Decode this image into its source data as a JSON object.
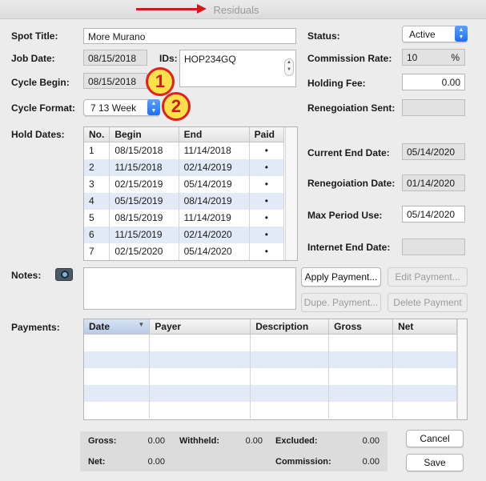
{
  "window": {
    "title": "Residuals"
  },
  "badges": {
    "one": "1",
    "two": "2"
  },
  "form": {
    "spot_title_label": "Spot Title:",
    "spot_title_value": "More Murano",
    "job_date_label": "Job Date:",
    "job_date_value": "08/15/2018",
    "ids_label": "IDs:",
    "ids_value": "HOP234GQ",
    "cycle_begin_label": "Cycle Begin:",
    "cycle_begin_value": "08/15/2018",
    "cycle_format_label": "Cycle Format:",
    "cycle_format_value": "7 13 Week",
    "hold_dates_label": "Hold Dates:",
    "notes_label": "Notes:",
    "payments_label": "Payments:"
  },
  "right": {
    "status_label": "Status:",
    "status_value": "Active",
    "commission_rate_label": "Commission Rate:",
    "commission_rate_value": "10",
    "commission_rate_unit": "%",
    "holding_fee_label": "Holding Fee:",
    "holding_fee_value": "0.00",
    "renegotiation_sent_label": "Renegoiation Sent:",
    "current_end_date_label": "Current End Date:",
    "current_end_date_value": "05/14/2020",
    "renegotiation_date_label": "Renegoiation Date:",
    "renegotiation_date_value": "01/14/2020",
    "max_period_use_label": "Max Period Use:",
    "max_period_use_value": "05/14/2020",
    "internet_end_date_label": "Internet End Date:"
  },
  "hold_dates": {
    "columns": [
      "No.",
      "Begin",
      "End",
      "Paid"
    ],
    "rows": [
      {
        "no": "1",
        "begin": "08/15/2018",
        "end": "11/14/2018",
        "paid": "•"
      },
      {
        "no": "2",
        "begin": "11/15/2018",
        "end": "02/14/2019",
        "paid": "•"
      },
      {
        "no": "3",
        "begin": "02/15/2019",
        "end": "05/14/2019",
        "paid": "•"
      },
      {
        "no": "4",
        "begin": "05/15/2019",
        "end": "08/14/2019",
        "paid": "•"
      },
      {
        "no": "5",
        "begin": "08/15/2019",
        "end": "11/14/2019",
        "paid": "•"
      },
      {
        "no": "6",
        "begin": "11/15/2019",
        "end": "02/14/2020",
        "paid": "•"
      },
      {
        "no": "7",
        "begin": "02/15/2020",
        "end": "05/14/2020",
        "paid": "•"
      }
    ]
  },
  "payment_buttons": {
    "apply": "Apply Payment...",
    "edit": "Edit Payment...",
    "dupe": "Dupe. Payment...",
    "delete": "Delete Payment"
  },
  "payments_table": {
    "columns": [
      "Date",
      "Payer",
      "Description",
      "Gross",
      "Net"
    ]
  },
  "totals": {
    "gross_label": "Gross:",
    "gross_value": "0.00",
    "withheld_label": "Withheld:",
    "withheld_value": "0.00",
    "excluded_label": "Excluded:",
    "excluded_value": "0.00",
    "net_label": "Net:",
    "net_value": "0.00",
    "commission_label": "Commission:",
    "commission_value": "0.00"
  },
  "actions": {
    "cancel": "Cancel",
    "save": "Save"
  },
  "colors": {
    "accent": "#1d6ff0",
    "alt_row": "#e3eaf7",
    "annotation": "#d11a1a"
  }
}
